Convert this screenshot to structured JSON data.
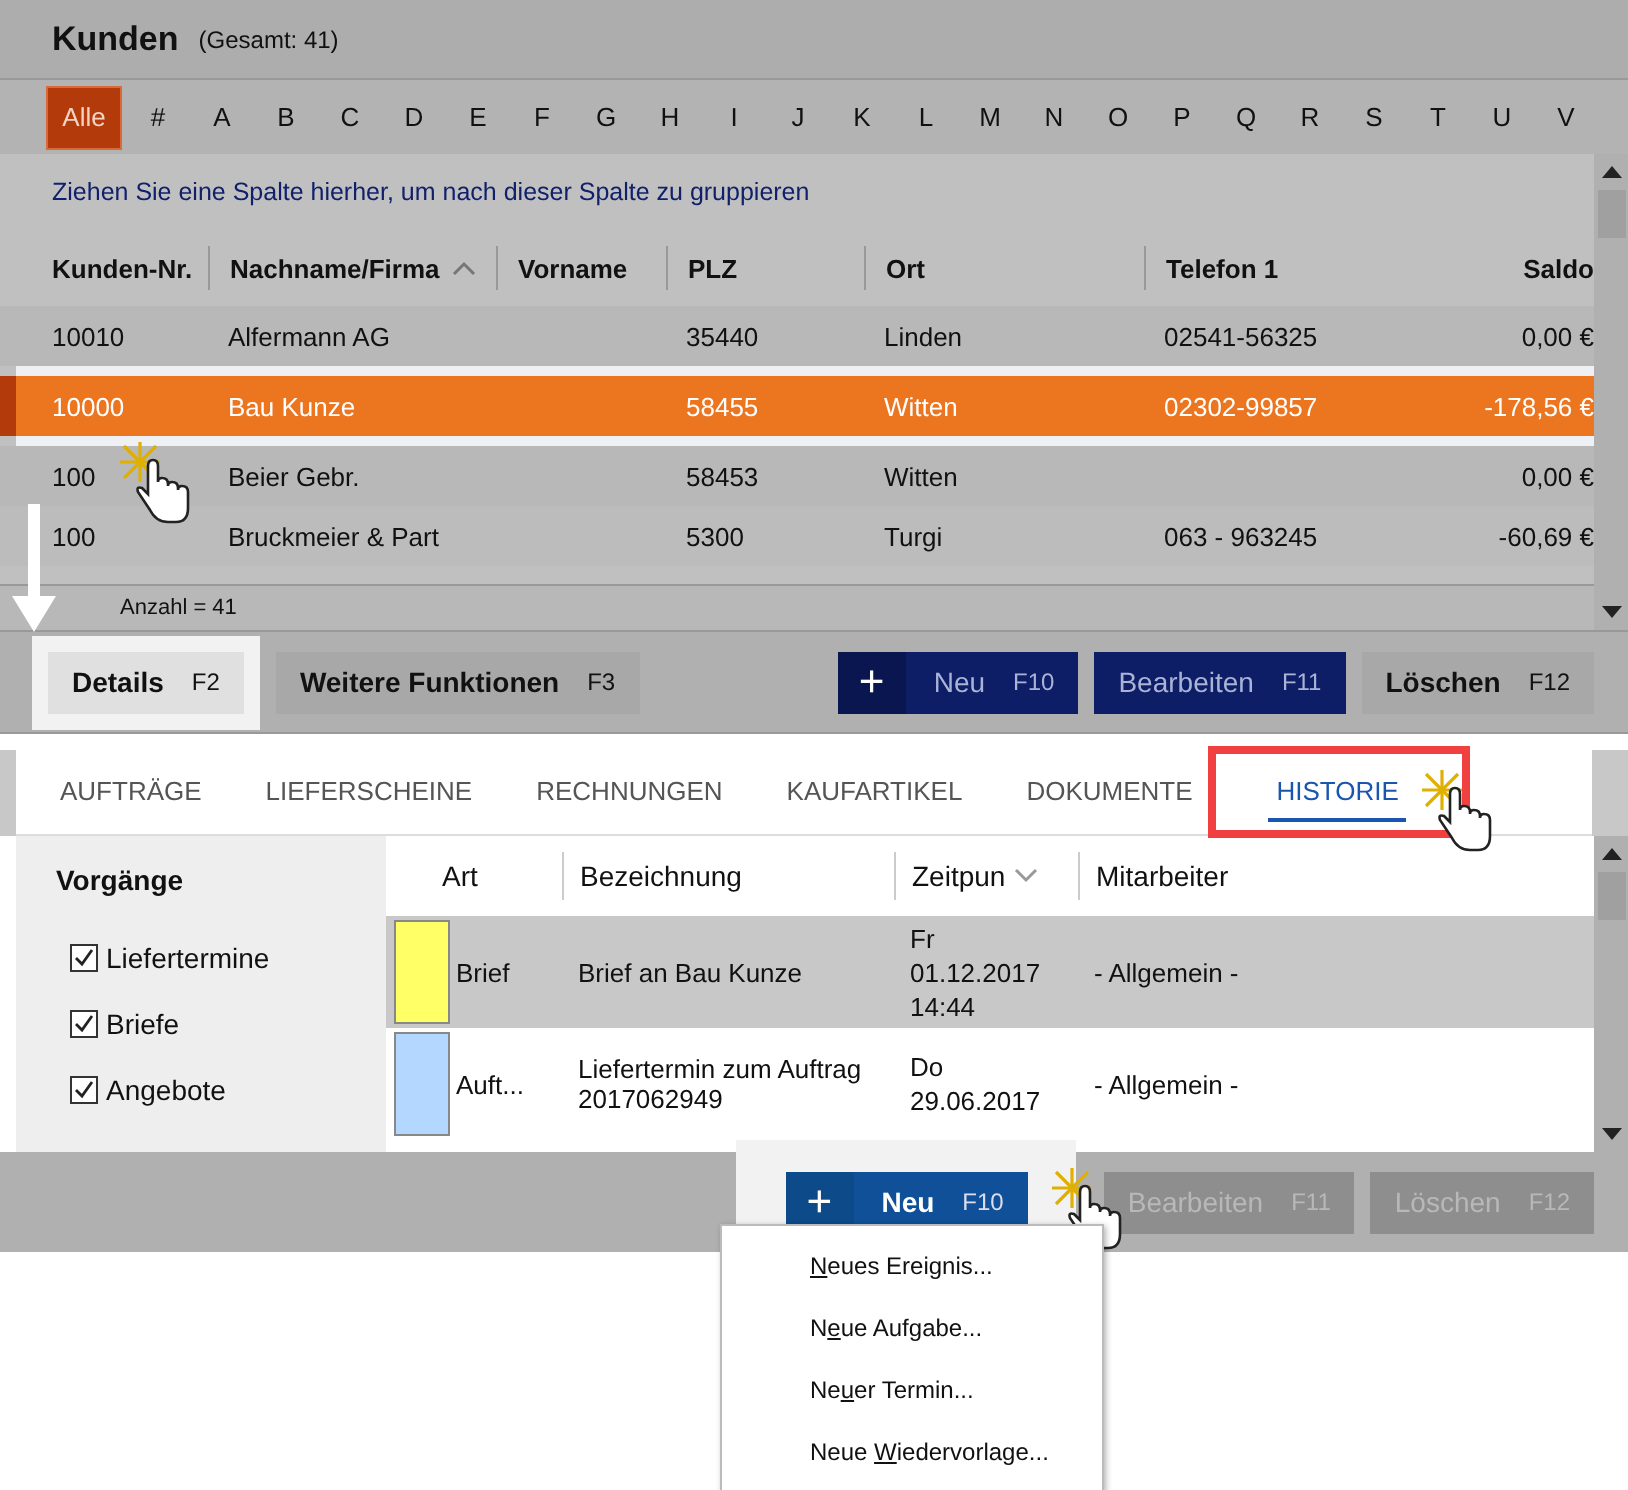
{
  "header": {
    "title": "Kunden",
    "total": "(Gesamt: 41)"
  },
  "letters": [
    {
      "label": "Alle",
      "selected": true
    },
    {
      "label": "#",
      "selected": false
    },
    {
      "label": "A",
      "selected": false
    },
    {
      "label": "B",
      "selected": false
    },
    {
      "label": "C",
      "selected": false
    },
    {
      "label": "D",
      "selected": false
    },
    {
      "label": "E",
      "selected": false
    },
    {
      "label": "F",
      "selected": false
    },
    {
      "label": "G",
      "selected": false
    },
    {
      "label": "H",
      "selected": false
    },
    {
      "label": "I",
      "selected": false
    },
    {
      "label": "J",
      "selected": false
    },
    {
      "label": "K",
      "selected": false
    },
    {
      "label": "L",
      "selected": false
    },
    {
      "label": "M",
      "selected": false
    },
    {
      "label": "N",
      "selected": false
    },
    {
      "label": "O",
      "selected": false
    },
    {
      "label": "P",
      "selected": false
    },
    {
      "label": "Q",
      "selected": false
    },
    {
      "label": "R",
      "selected": false
    },
    {
      "label": "S",
      "selected": false
    },
    {
      "label": "T",
      "selected": false
    },
    {
      "label": "U",
      "selected": false
    },
    {
      "label": "V",
      "selected": false
    }
  ],
  "grid": {
    "group_hint": "Ziehen Sie eine Spalte hierher, um nach dieser Spalte zu gruppieren",
    "columns": [
      {
        "label": "Kunden-Nr.",
        "sorted": false
      },
      {
        "label": "Nachname/Firma",
        "sorted": true
      },
      {
        "label": "Vorname",
        "sorted": false
      },
      {
        "label": "PLZ",
        "sorted": false
      },
      {
        "label": "Ort",
        "sorted": false
      },
      {
        "label": "Telefon 1",
        "sorted": false
      },
      {
        "label": "Saldo",
        "sorted": false
      }
    ],
    "rows": [
      {
        "cells": [
          "10010",
          "Alfermann AG",
          "",
          "35440",
          "Linden",
          "02541-56325",
          "0,00 €"
        ],
        "selected": false
      },
      {
        "cells": [
          "10000",
          "Bau Kunze",
          "",
          "58455",
          "Witten",
          "02302-99857",
          "-178,56 €"
        ],
        "selected": true
      },
      {
        "cells": [
          "100",
          "Beier Gebr.",
          "",
          "58453",
          "Witten",
          "",
          "0,00 €"
        ],
        "selected": false
      },
      {
        "cells": [
          "100",
          "Bruckmeier & Part",
          "",
          "5300",
          "Turgi",
          "063 - 963245",
          "-60,69 €"
        ],
        "selected": false
      }
    ],
    "footer": "Anzahl = 41"
  },
  "actions": [
    {
      "kind": "plain",
      "label": "Details",
      "key": "F2",
      "highlighted": true
    },
    {
      "kind": "plain",
      "label": "Weitere Funktionen",
      "key": "F3",
      "highlighted": false
    },
    {
      "kind": "spacer"
    },
    {
      "kind": "add",
      "icon": "+",
      "label": "Neu",
      "key": "F10",
      "highlighted": false
    },
    {
      "kind": "primary",
      "label": "Bearbeiten",
      "key": "F11",
      "highlighted": false
    },
    {
      "kind": "plain",
      "label": "Löschen",
      "key": "F12",
      "highlighted": false
    }
  ],
  "tabs": [
    {
      "label": "AUFTRÄGE",
      "selected": false,
      "highlighted": false
    },
    {
      "label": "LIEFERSCHEINE",
      "selected": false,
      "highlighted": false
    },
    {
      "label": "RECHNUNGEN",
      "selected": false,
      "highlighted": false
    },
    {
      "label": "KAUFARTIKEL",
      "selected": false,
      "highlighted": false
    },
    {
      "label": "DOKUMENTE",
      "selected": false,
      "highlighted": false
    },
    {
      "label": "HISTORIE",
      "selected": true,
      "highlighted": true
    }
  ],
  "sidebar": {
    "title": "Vorgänge",
    "filters": [
      {
        "label": "Liefertermine",
        "checked": true
      },
      {
        "label": "Briefe",
        "checked": true
      },
      {
        "label": "Angebote",
        "checked": true
      }
    ]
  },
  "history": {
    "columns": [
      {
        "label": "Art",
        "dropdown": false
      },
      {
        "label": "Bezeichnung",
        "dropdown": false
      },
      {
        "label": "Zeitpun",
        "dropdown": true
      },
      {
        "label": "Mitarbeiter",
        "dropdown": false
      }
    ],
    "rows": [
      {
        "color": "#ffff66",
        "art": "Brief",
        "title": "Brief an Bau Kunze",
        "time": [
          "Fr",
          "01.12.2017",
          "14:44"
        ],
        "staff": "- Allgemein -",
        "selected": true
      },
      {
        "color": "#b3d7ff",
        "art": "Auft...",
        "title": "Liefertermin zum Auftrag 2017062949",
        "time": [
          "Do",
          "29.06.2017"
        ],
        "staff": "- Allgemein -",
        "selected": false
      }
    ]
  },
  "bottom_actions": [
    {
      "kind": "add",
      "icon": "+",
      "label": "Neu",
      "key": "F10",
      "disabled": false,
      "highlighted": true
    },
    {
      "kind": "plain",
      "label": "Bearbeiten",
      "key": "F11",
      "disabled": true,
      "highlighted": false
    },
    {
      "kind": "plain",
      "label": "Löschen",
      "key": "F12",
      "disabled": true,
      "highlighted": false
    }
  ],
  "menu": [
    {
      "parts": [
        {
          "text": "N",
          "underlined": true
        },
        {
          "text": "eues Ereignis...",
          "underlined": false
        }
      ]
    },
    {
      "parts": [
        {
          "text": "N",
          "underlined": false
        },
        {
          "text": "e",
          "underlined": true
        },
        {
          "text": "ue Aufgabe...",
          "underlined": false
        }
      ]
    },
    {
      "parts": [
        {
          "text": "Ne",
          "underlined": false
        },
        {
          "text": "u",
          "underlined": true
        },
        {
          "text": "er Termin...",
          "underlined": false
        }
      ]
    },
    {
      "parts": [
        {
          "text": "Neue ",
          "underlined": false
        },
        {
          "text": "W",
          "underlined": true
        },
        {
          "text": "iedervorlage...",
          "underlined": false
        }
      ]
    }
  ]
}
